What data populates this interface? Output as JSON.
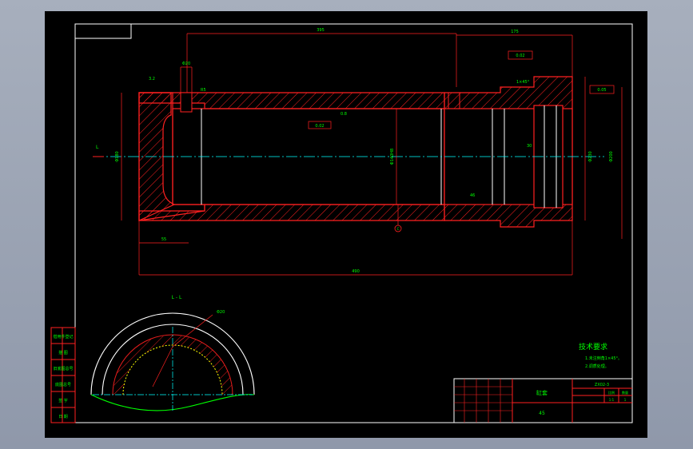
{
  "colors": {
    "background": "#000000",
    "frame": "#ffffff",
    "outline": "#ff2020",
    "hatch": "#ff2020",
    "dimension": "#ff2020",
    "centerline": "#00ffff",
    "annotation_text": "#00ff00",
    "detail_arc": "#ffff00",
    "section_curve": "#00ff00"
  },
  "section_label": "L - L",
  "datum_label": "C",
  "tech_req": {
    "title": "技术要求",
    "line1": "1.未注倒角1×45°。",
    "line2": "2.调质处理。"
  },
  "title_block": {
    "part_name": "缸套",
    "material": "45",
    "drawing_no": "ZX02-3",
    "scale_label": "比例",
    "qty_label": "数量",
    "scale_value": "1:1",
    "qty_value": "1"
  },
  "side_stamps": [
    "借用件登记",
    "描 图",
    "旧底图总号",
    "底图总号",
    "签 字",
    "日 期"
  ],
  "dims": {
    "overall_length": "490",
    "top_span": "395",
    "right_span": "175",
    "hole_dim": "Φ20",
    "bore_dia": "Φ140H8",
    "outer_dia": "Φ200",
    "flange_dia": "Φ230",
    "left_dia": "Φ180",
    "small_dim": "30",
    "bottom_left": "55",
    "rough_1": "3.2",
    "rough_2": "0.8",
    "tol_1": "0.02",
    "tol_2": "0.05",
    "chamfer": "1×45°",
    "radius": "R5",
    "depth": "46"
  }
}
